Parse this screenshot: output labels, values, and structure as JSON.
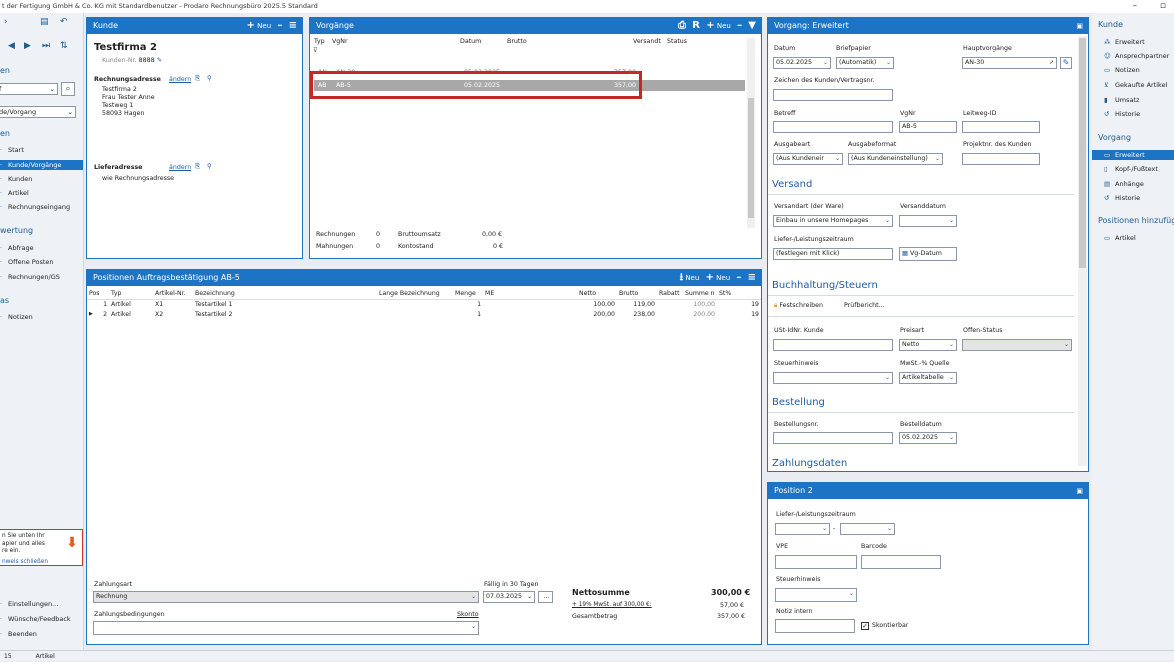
{
  "window": {
    "title": "t der Fertigung GmbH & Co. KG mit Standardbenutzer  -  Prodaro Rechnungsbüro 2025.5 Standard",
    "minimize": "–",
    "maximize": "▫"
  },
  "leftnav": {
    "section1": "en",
    "select1": "f",
    "select2": "de/Vorgang",
    "section2": "en",
    "items": [
      "Start",
      "Kunde/Vorgänge",
      "Kunden",
      "Artikel",
      "Rechnungseingang"
    ],
    "section3": "wertung",
    "items2": [
      "Abfrage",
      "Offene Posten",
      "Rechnungen/GS"
    ],
    "section4": "as",
    "items3": [
      "Notizen"
    ],
    "hint": [
      "n Sie unten Ihr",
      "apier und alles",
      "re ein."
    ],
    "hint_close": "nweis schließen",
    "bottom_items": [
      "Einstellungen...",
      "Wünsche/Feedback",
      "Beenden"
    ]
  },
  "kunde": {
    "title": "Kunde",
    "new_label": "Neu",
    "name": "Testfirma 2",
    "kunden_nr_label": "Kunden-Nr.",
    "kunden_nr": "8888",
    "rechnungsadresse_label": "Rechnungsadresse",
    "aendern": "ändern",
    "address": [
      "Testfirma 2",
      "Frau Tester Anne",
      "Testweg 1",
      "58093 Hagen"
    ],
    "lieferadresse_label": "Lieferadresse",
    "lieferadresse": "wie Rechnungsadresse"
  },
  "vorgaenge": {
    "title": "Vorgänge",
    "new_label": "Neu",
    "columns": [
      "Typ",
      "VgNr",
      "Datum",
      "Brutto",
      "Versandt",
      "Status"
    ],
    "rows": [
      {
        "typ": "AN",
        "nr": "AN-30",
        "datum": "05.02.2025",
        "brutto": "357,00"
      },
      {
        "typ": "AB",
        "nr": "AB-5",
        "datum": "05.02.2025",
        "brutto": "357,00"
      }
    ],
    "summary": {
      "rechnungen_label": "Rechnungen",
      "rechnungen": "0",
      "mahnungen_label": "Mahnungen",
      "mahnungen": "0",
      "bruttoumsatz_label": "Bruttoumsatz",
      "bruttoumsatz": "0,00 €",
      "kontostand_label": "Kontostand",
      "kontostand": "0 €"
    }
  },
  "positionen": {
    "title": "Positionen Auftragsbestätigung AB-5",
    "new_label": "Neu",
    "new2_label": "Neu",
    "columns": [
      "Pos",
      "Typ",
      "Artikel-Nr.",
      "Bezeichnung",
      "Lange Bezeichnung",
      "Menge",
      "ME",
      "Netto",
      "Brutto",
      "Rabatt",
      "Summe n",
      "St%"
    ],
    "rows": [
      {
        "pos": "1",
        "typ": "Artikel",
        "nr": "X1",
        "bez": "Testartikel 1",
        "menge": "1",
        "netto": "100,00",
        "brutto": "119,00",
        "summe": "100,00",
        "st": "19"
      },
      {
        "pos": "2",
        "typ": "Artikel",
        "nr": "X2",
        "bez": "Testartikel 2",
        "menge": "1",
        "netto": "200,00",
        "brutto": "238,00",
        "summe": "200,00",
        "st": "19"
      }
    ],
    "zahlungsart_label": "Zahlungsart",
    "zahlungsart": "Rechnung",
    "faellig_label": "Fällig in 30 Tagen",
    "faellig_date": "07.03.2025",
    "faellig_btn": "...",
    "bedingungen_label": "Zahlungsbedingungen",
    "skonto_label": "Skonto",
    "nettosumme_label": "Nettosumme",
    "nettosumme": "300,00 €",
    "mwst_label": "+ 19% MwSt. auf 300,00 €:",
    "mwst": "57,00 €",
    "gesamt_label": "Gesamtbetrag",
    "gesamt": "357,00 €"
  },
  "erweitert": {
    "title": "Vorgang: Erweitert",
    "datum_label": "Datum",
    "datum": "05.02.2025",
    "briefpapier_label": "Briefpapier",
    "briefpapier": "(Automatik)",
    "haupt_label": "Hauptvorgänge",
    "haupt": "AN-30",
    "zeichen_label": "Zeichen des Kunden/Vertragsnr.",
    "betreff_label": "Betreff",
    "vgnr_label": "VgNr",
    "vgnr": "AB-5",
    "leitweg_label": "Leitweg-ID",
    "ausgabeart_label": "Ausgabeart",
    "ausgabeart": "(Aus Kundeneir",
    "ausgabeformat_label": "Ausgabeformat",
    "ausgabeformat": "(Aus Kundeneinstellung)",
    "projekt_label": "Projektnr. des Kunden",
    "versand_head": "Versand",
    "versandart_label": "Versandart (der Ware)",
    "versandart": "Einbau in unsere Homepages",
    "versanddatum_label": "Versanddatum",
    "liefer_label": "Liefer-/Leistungszeitraum",
    "liefer": "(festlegen mit Klick)",
    "vgdatum_btn": "Vg-Datum",
    "buch_head": "Buchhaltung/Steuern",
    "festschreiben": "Festschreiben",
    "pruefbericht": "Prüfbericht...",
    "ustid_label": "USt-IdNr. Kunde",
    "preisart_label": "Preisart",
    "preisart": "Netto",
    "offen_label": "Offen-Status",
    "steuerhinweis_label": "Steuerhinweis",
    "mwstquelle_label": "MwSt.-% Quelle",
    "mwstquelle": "Artikeltabelle",
    "bestellung_head": "Bestellung",
    "bestellnr_label": "Bestellungsnr.",
    "bestelldatum_label": "Bestelldatum",
    "bestelldatum": "05.02.2025",
    "zahlungsdaten_head": "Zahlungsdaten"
  },
  "position2": {
    "title": "Position 2",
    "liefer_label": "Liefer-/Leistungszeitraum",
    "vpe_label": "VPE",
    "barcode_label": "Barcode",
    "steuerhinweis_label": "Steuerhinweis",
    "notiz_label": "Notiz intern",
    "skontierbar_label": "Skontierbar"
  },
  "rightnav": {
    "kunde_head": "Kunde",
    "kunde_items": [
      "Erweitert",
      "Ansprechpartner",
      "Notizen",
      "Gekaufte Artikel",
      "Umsatz",
      "Historie"
    ],
    "vorgang_head": "Vorgang",
    "vorgang_items": [
      "Erweitert",
      "Kopf-/Fußtext",
      "Anhänge",
      "Historie"
    ],
    "pos_head": "Positionen hinzufügen",
    "pos_items": [
      "Artikel"
    ]
  },
  "statusbar": {
    "left": "15",
    "tab": "Artikel"
  },
  "colors": {
    "accent": "#1e74c4",
    "highlight": "#c62828"
  }
}
